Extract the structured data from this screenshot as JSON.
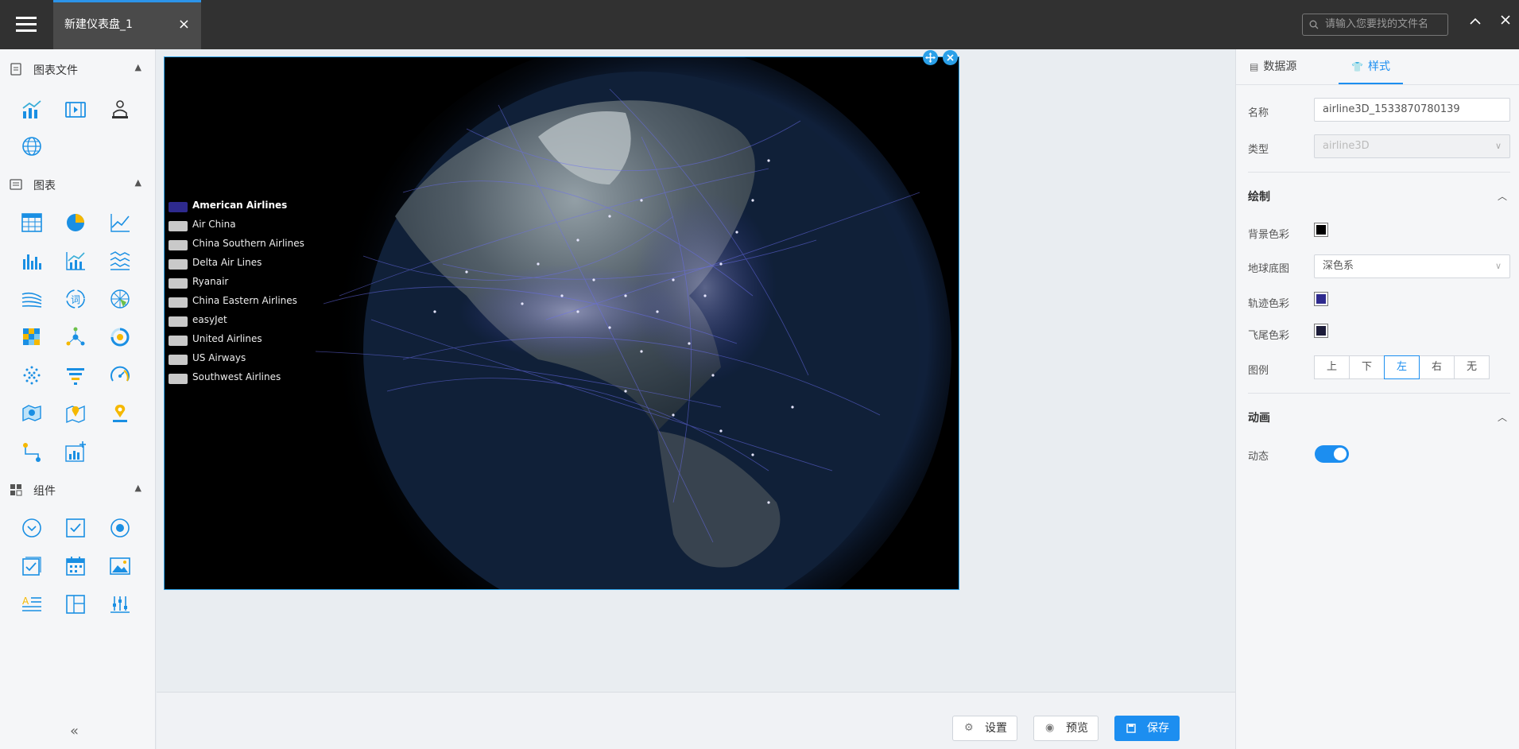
{
  "topbar": {
    "tab_title": "新建仪表盘_1",
    "tab_close": "×",
    "search_placeholder": "请输入您要找的文件名",
    "collapse_symbol": "︿",
    "close_symbol": "✕"
  },
  "sidebar": {
    "sections": [
      {
        "title": "图表文件",
        "icon": "file-chart-icon"
      },
      {
        "title": "图表",
        "icon": "chart-list-icon"
      },
      {
        "title": "组件",
        "icon": "component-icon"
      }
    ],
    "collapse_symbol": "«"
  },
  "chart": {
    "legend": [
      {
        "label": "American Airlines",
        "active": true,
        "color": "#2e2a8e"
      },
      {
        "label": "Air China",
        "active": false,
        "color": "#c9c9c9"
      },
      {
        "label": "China Southern Airlines",
        "active": false,
        "color": "#c9c9c9"
      },
      {
        "label": "Delta Air Lines",
        "active": false,
        "color": "#c9c9c9"
      },
      {
        "label": "Ryanair",
        "active": false,
        "color": "#c9c9c9"
      },
      {
        "label": "China Eastern Airlines",
        "active": false,
        "color": "#c9c9c9"
      },
      {
        "label": "easyJet",
        "active": false,
        "color": "#c9c9c9"
      },
      {
        "label": "United Airlines",
        "active": false,
        "color": "#c9c9c9"
      },
      {
        "label": "US Airways",
        "active": false,
        "color": "#c9c9c9"
      },
      {
        "label": "Southwest Airlines",
        "active": false,
        "color": "#c9c9c9"
      }
    ]
  },
  "bottom": {
    "settings": "设置",
    "preview": "预览",
    "save": "保存"
  },
  "right_panel": {
    "tabs": [
      "数据源",
      "样式"
    ],
    "active_tab": "样式",
    "name_label": "名称",
    "name_value": "airline3D_1533870780139",
    "type_label": "类型",
    "type_value": "airline3D",
    "draw_section": "绘制",
    "bg_color_label": "背景色彩",
    "bg_color": "#000000",
    "earth_base_label": "地球底图",
    "earth_base_value": "深色系",
    "track_color_label": "轨迹色彩",
    "track_color": "#2e2a8e",
    "tail_color_label": "飞尾色彩",
    "tail_color": "#1c1c3a",
    "legend_label": "图例",
    "legend_options": [
      "上",
      "下",
      "左",
      "右",
      "无"
    ],
    "legend_selected": "左",
    "anim_section": "动画",
    "dynamic_label": "动态",
    "dynamic_on": true
  }
}
